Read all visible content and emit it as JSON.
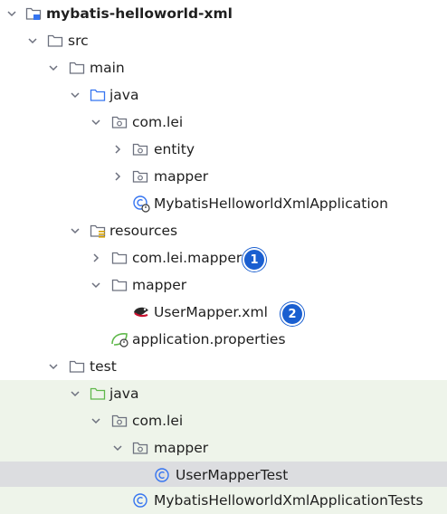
{
  "project": {
    "label": "mybatis-helloworld-xml"
  },
  "src": {
    "label": "src"
  },
  "main": {
    "label": "main"
  },
  "main_java": {
    "label": "java"
  },
  "main_pkg": {
    "label": "com.lei"
  },
  "entity": {
    "label": "entity"
  },
  "mapper_pkg": {
    "label": "mapper"
  },
  "app_class": {
    "label": "MybatisHelloworldXmlApplication"
  },
  "resources": {
    "label": "resources"
  },
  "res_com_lei_mapper": {
    "label": "com.lei.mapper",
    "badge": "1"
  },
  "res_mapper": {
    "label": "mapper"
  },
  "user_mapper_xml": {
    "label": "UserMapper.xml",
    "badge": "2"
  },
  "app_props": {
    "label": "application.properties"
  },
  "test": {
    "label": "test"
  },
  "test_java": {
    "label": "java"
  },
  "test_pkg": {
    "label": "com.lei"
  },
  "test_mapper": {
    "label": "mapper"
  },
  "user_mapper_test": {
    "label": "UserMapperTest"
  },
  "app_tests": {
    "label": "MybatisHelloworldXmlApplicationTests"
  },
  "colors": {
    "source_root": "#3574f0",
    "test_root": "#5fb84a",
    "badge": "#1a5fd0",
    "test_bg": "#eef4ea",
    "selected_bg": "#dcdde0"
  },
  "icons": [
    "module-folder-icon",
    "folder-icon",
    "source-folder-icon",
    "package-icon",
    "resources-folder-icon",
    "test-folder-icon",
    "class-icon",
    "spring-boot-class-icon",
    "mybatis-xml-icon",
    "spring-properties-icon",
    "chevron-down-icon",
    "chevron-right-icon"
  ]
}
